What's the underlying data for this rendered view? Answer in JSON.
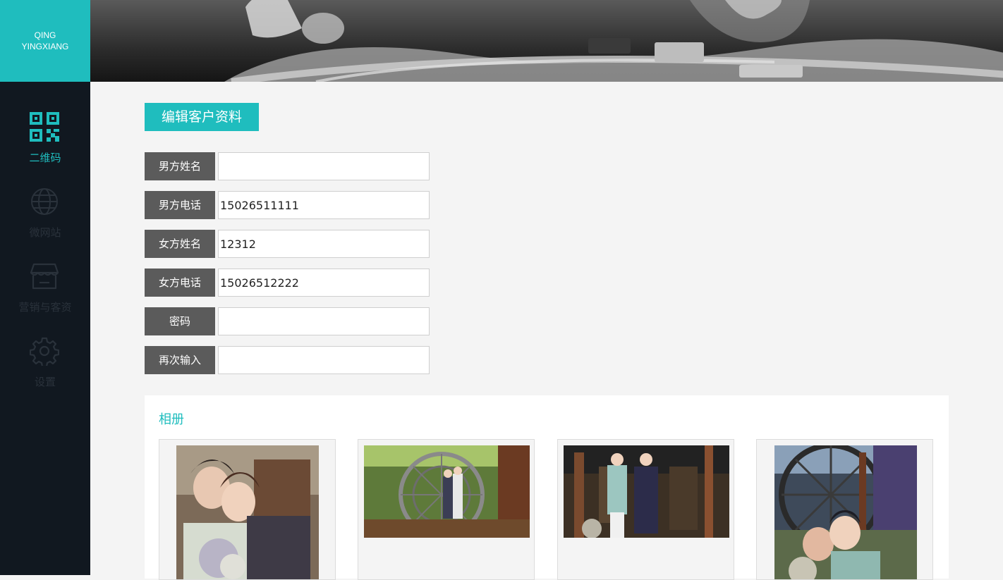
{
  "sidebar": {
    "logo": {
      "line1": "QING",
      "line2": "YINGXIANG"
    },
    "items": [
      {
        "label": "二维码",
        "icon": "qr-code-icon",
        "active": true
      },
      {
        "label": "微网站",
        "icon": "globe-icon",
        "active": false
      },
      {
        "label": "营销与客资",
        "icon": "store-icon",
        "active": false
      },
      {
        "label": "设置",
        "icon": "gear-icon",
        "active": false
      }
    ]
  },
  "page": {
    "title": "编辑客户资料",
    "form": [
      {
        "label": "男方姓名",
        "value": ""
      },
      {
        "label": "男方电话",
        "value": "15026511111"
      },
      {
        "label": "女方姓名",
        "value": "12312"
      },
      {
        "label": "女方电话",
        "value": "15026512222"
      },
      {
        "label": "密码",
        "value": ""
      },
      {
        "label": "再次输入",
        "value": ""
      }
    ]
  },
  "album": {
    "title": "相册",
    "photos": [
      {
        "name": "wedding-photo-1"
      },
      {
        "name": "wedding-photo-2"
      },
      {
        "name": "wedding-photo-3"
      },
      {
        "name": "wedding-photo-4"
      }
    ]
  },
  "colors": {
    "accent": "#1fbdbe",
    "sidebar_bg": "#111820",
    "label_bg": "#5b5b5b",
    "page_bg": "#f4f4f4"
  }
}
